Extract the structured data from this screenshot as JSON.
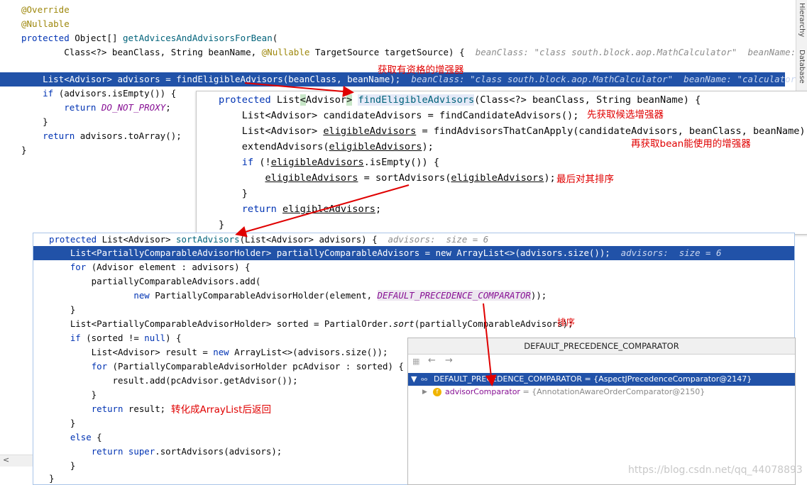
{
  "panel1": {
    "lines": [
      "@Override",
      "@Nullable",
      "protected Object[] getAdvicesAndAdvisorsForBean(",
      "        Class<?> beanClass, String beanName, @Nullable TargetSource targetSource) {",
      "    List<Advisor> advisors = findEligibleAdvisors(beanClass, beanName);",
      "    if (advisors.isEmpty()) {",
      "        return DO_NOT_PROXY;",
      "    }",
      "    return advisors.toArray();",
      "}"
    ],
    "hint_line4": "beanClass: \"class south.block.aop.MathCalculator\"  beanName: \"calcu",
    "hint_line5": "beanClass: \"class south.block.aop.MathCalculator\"  beanName: \"calculator\""
  },
  "panel2": {
    "lines": [
      "protected List<Advisor> findEligibleAdvisors(Class<?> beanClass, String beanName) {",
      "    List<Advisor> candidateAdvisors = findCandidateAdvisors();",
      "    List<Advisor> eligibleAdvisors = findAdvisorsThatCanApply(candidateAdvisors, beanClass, beanName);",
      "    extendAdvisors(eligibleAdvisors);",
      "    if (!eligibleAdvisors.isEmpty()) {",
      "        eligibleAdvisors = sortAdvisors(eligibleAdvisors);",
      "    }",
      "    return eligibleAdvisors;",
      "}"
    ]
  },
  "panel3": {
    "lines": [
      "protected List<Advisor> sortAdvisors(List<Advisor> advisors) {",
      "    List<PartiallyComparableAdvisorHolder> partiallyComparableAdvisors = new ArrayList<>(advisors.size());",
      "    for (Advisor element : advisors) {",
      "        partiallyComparableAdvisors.add(",
      "                new PartiallyComparableAdvisorHolder(element, DEFAULT_PRECEDENCE_COMPARATOR));",
      "    }",
      "    List<PartiallyComparableAdvisorHolder> sorted = PartialOrder.sort(partiallyComparableAdvisors);",
      "    if (sorted != null) {",
      "        List<Advisor> result = new ArrayList<>(advisors.size());",
      "        for (PartiallyComparableAdvisorHolder pcAdvisor : sorted) {",
      "            result.add(pcAdvisor.getAdvisor());",
      "        }",
      "        return result;",
      "    }",
      "    else {",
      "        return super.sortAdvisors(advisors);",
      "    }",
      "}"
    ],
    "hint_line1": "advisors:  size = 6",
    "hint_line2": "advisors:  size = 6"
  },
  "annotations": {
    "get_eligible": "获取有资格的增强器",
    "get_candidates": "先获取候选增强器",
    "get_usable": "再获取bean能使用的增强器",
    "sort_last": "最后对其排序",
    "sort": "排序",
    "to_arraylist": "转化成ArrayList后返回"
  },
  "debug_popup": {
    "title": "DEFAULT_PRECEDENCE_COMPARATOR",
    "row1": "DEFAULT_PRECEDENCE_COMPARATOR = {AspectJPrecedenceComparator@2147}",
    "row2_name": "advisorComparator",
    "row2_value": " = {AnnotationAwareOrderComparator@2150}"
  },
  "side_tabs": {
    "hierarchy": "Hierarchy",
    "database": "Database"
  },
  "watermark": "https://blog.csdn.net/qq_44078893",
  "colors": {
    "selection": "#2152a8",
    "annotation": "#e00000",
    "keyword": "#0033b3"
  }
}
